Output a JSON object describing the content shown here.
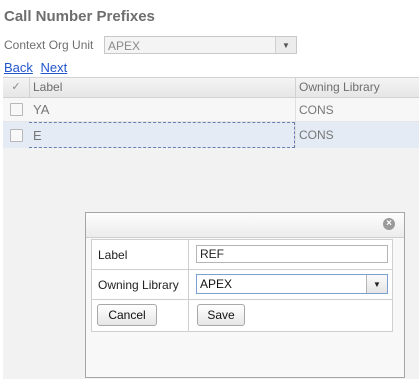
{
  "page": {
    "title": "Call Number Prefixes",
    "context_org_unit": {
      "label": "Context Org Unit",
      "value": "APEX"
    },
    "nav": {
      "back": "Back",
      "next": "Next"
    }
  },
  "grid": {
    "columns": {
      "check": "✓",
      "label": "Label",
      "owning_library": "Owning Library"
    },
    "rows": [
      {
        "label": "YA",
        "owning_library": "CONS",
        "selected": false
      },
      {
        "label": "E",
        "owning_library": "CONS",
        "selected": true
      }
    ]
  },
  "dialog": {
    "close_icon": "close-icon",
    "fields": {
      "label": {
        "label": "Label",
        "value": "REF"
      },
      "owning_library": {
        "label": "Owning Library",
        "value": "APEX"
      }
    },
    "buttons": {
      "cancel": "Cancel",
      "save": "Save"
    }
  },
  "colors": {
    "link": "#2255cc",
    "selected_row": "#e4ebf4",
    "header_text": "#6e6e6e"
  }
}
